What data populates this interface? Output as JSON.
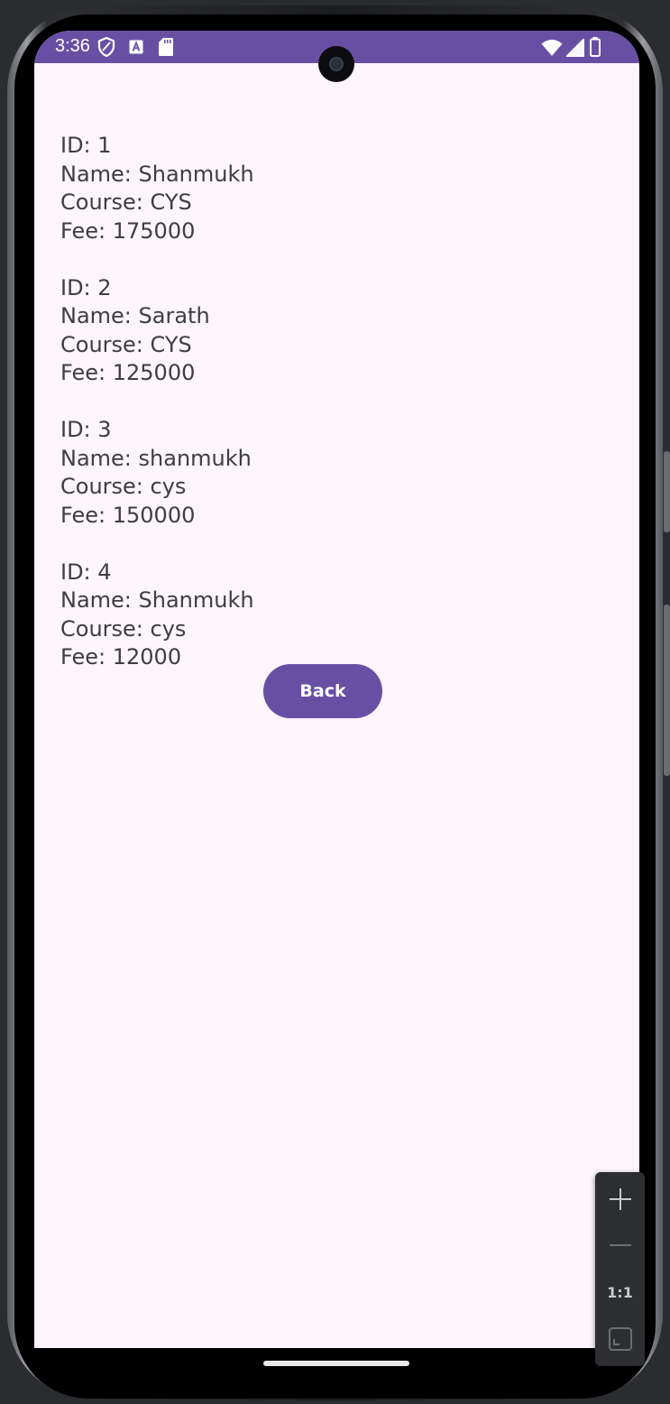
{
  "status_bar": {
    "time": "3:36",
    "color": "#6750a4",
    "left_icons": [
      "shield-icon",
      "a-box-icon",
      "sd-card-icon"
    ],
    "right_icons": [
      "wifi-icon",
      "signal-icon",
      "battery-icon"
    ]
  },
  "records": [
    {
      "id": "ID: 1",
      "name": "Name: Shanmukh",
      "course": "Course: CYS",
      "fee": "Fee: 175000"
    },
    {
      "id": "ID: 2",
      "name": "Name: Sarath",
      "course": "Course: CYS",
      "fee": "Fee: 125000"
    },
    {
      "id": "ID: 3",
      "name": "Name: shanmukh",
      "course": "Course: cys",
      "fee": "Fee: 150000"
    },
    {
      "id": "ID: 4",
      "name": "Name: Shanmukh",
      "course": "Course: cys",
      "fee": "Fee: 12000"
    }
  ],
  "back_button": {
    "label": "Back",
    "color": "#6750a4"
  },
  "emulator_zoom": {
    "zoom_in_icon": "plus-icon",
    "zoom_out_icon": "minus-icon",
    "actual_size_label": "1:1",
    "fit_icon": "fit-screen-icon"
  },
  "colors": {
    "screen_background": "#fcf5fc",
    "text": "#3e3c44",
    "accent": "#6750a4"
  }
}
